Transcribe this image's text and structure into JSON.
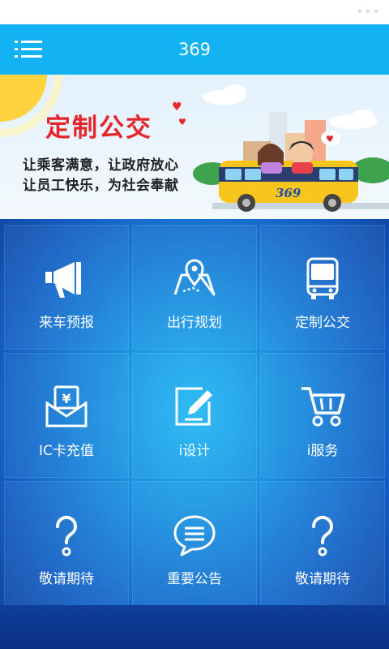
{
  "app": {
    "title": "369"
  },
  "header": {
    "menu_icon": "hamburger-icon"
  },
  "banner": {
    "title": "定制公交",
    "line1": "让乘客满意，让政府放心",
    "line2": "让员工快乐，为社会奉献",
    "bus_number": "369"
  },
  "colors": {
    "appbar": "#11b3f2",
    "banner_title": "#e6252a",
    "bus_yellow": "#f7c51c"
  },
  "tiles": [
    {
      "label": "来车预报",
      "icon": "megaphone-icon"
    },
    {
      "label": "出行规划",
      "icon": "map-pin-icon"
    },
    {
      "label": "定制公交",
      "icon": "bus-icon"
    },
    {
      "label": "IC卡充值",
      "icon": "money-envelope-icon"
    },
    {
      "label": "i设计",
      "icon": "edit-icon"
    },
    {
      "label": "i服务",
      "icon": "shopping-cart-icon"
    },
    {
      "label": "敬请期待",
      "icon": "question-icon"
    },
    {
      "label": "重要公告",
      "icon": "chat-bubble-icon"
    },
    {
      "label": "敬请期待",
      "icon": "question-icon"
    }
  ]
}
